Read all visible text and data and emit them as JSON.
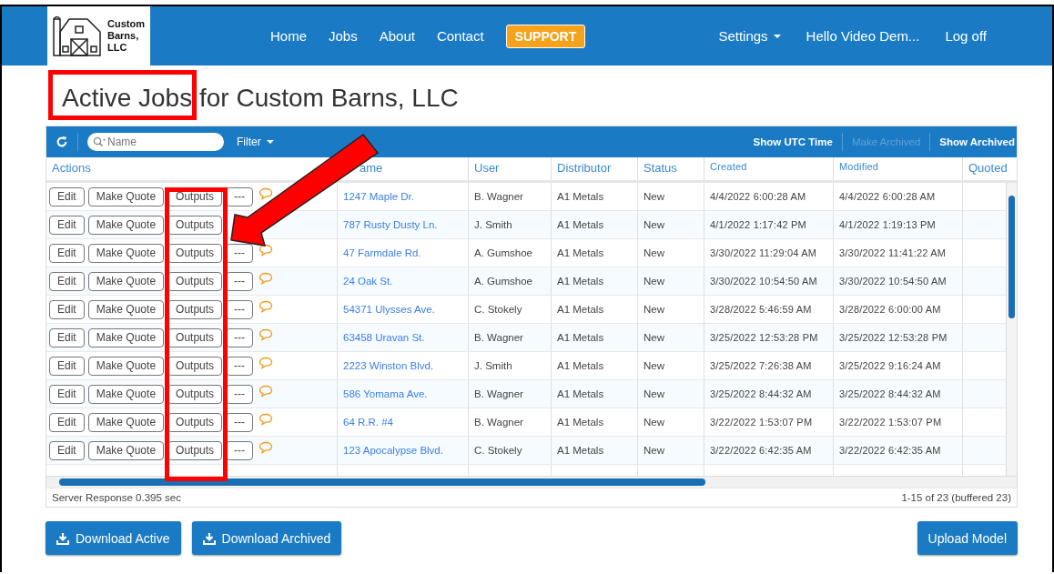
{
  "nav": {
    "logo_text": "Custom Barns, LLC",
    "links": [
      {
        "label": "Home",
        "kind": "link"
      },
      {
        "label": "Jobs",
        "kind": "link"
      },
      {
        "label": "About",
        "kind": "link"
      },
      {
        "label": "Contact",
        "kind": "link"
      },
      {
        "label": "SUPPORT",
        "kind": "highlight"
      }
    ],
    "right": [
      {
        "label": "Settings",
        "kind": "dropdown"
      },
      {
        "label": "Hello Video Dem...",
        "kind": "link"
      },
      {
        "label": "Log off",
        "kind": "link"
      }
    ]
  },
  "heading": "Active Jobs for Custom Barns, LLC",
  "toolbar": {
    "search": {
      "placeholder": "Name"
    },
    "filter": "Filter",
    "actions": [
      {
        "label": "Show UTC Time",
        "disabled": false
      },
      {
        "label": "Make Archived",
        "disabled": true
      },
      {
        "label": "Show Archived",
        "disabled": false
      }
    ]
  },
  "table": {
    "columns": [
      "Actions",
      "ame",
      "User",
      "Distributor",
      "Status",
      "Created",
      "Modified",
      "Quoted"
    ],
    "rows": [
      {
        "actions": [
          {
            "kind": "button",
            "label": "Edit"
          },
          {
            "kind": "button",
            "label": "Make Quote"
          },
          {
            "kind": "button",
            "label": "Outputs"
          },
          {
            "kind": "button",
            "label": "---"
          },
          {
            "kind": "comment"
          }
        ],
        "name": "1247 Maple Dr.",
        "user": "B. Wagner",
        "distributor": "A1 Metals",
        "status": "New",
        "created": "4/4/2022 6:00:28 AM",
        "modified": "4/4/2022 6:00:28 AM"
      },
      {
        "actions": [
          {
            "kind": "button",
            "label": "Edit"
          },
          {
            "kind": "button",
            "label": "Make Quote"
          },
          {
            "kind": "button",
            "label": "Outputs"
          }
        ],
        "name": "787 Rusty Dusty Ln.",
        "user": "J. Smith",
        "distributor": "A1 Metals",
        "status": "New",
        "created": "4/1/2022 1:17:42 PM",
        "modified": "4/1/2022 1:19:13 PM"
      },
      {
        "actions": [
          {
            "kind": "button",
            "label": "Edit"
          },
          {
            "kind": "button",
            "label": "Make Quote"
          },
          {
            "kind": "button",
            "label": "Outputs"
          },
          {
            "kind": "button",
            "label": "---"
          },
          {
            "kind": "comment"
          }
        ],
        "name": "47 Farmdale Rd.",
        "user": "A. Gumshoe",
        "distributor": "A1 Metals",
        "status": "New",
        "created": "3/30/2022 11:29:04 AM",
        "modified": "3/30/2022 11:41:22 AM"
      },
      {
        "actions": [
          {
            "kind": "button",
            "label": "Edit"
          },
          {
            "kind": "button",
            "label": "Make Quote"
          },
          {
            "kind": "button",
            "label": "Outputs"
          },
          {
            "kind": "button",
            "label": "---"
          },
          {
            "kind": "comment"
          }
        ],
        "name": "24 Oak St.",
        "user": "A. Gumshoe",
        "distributor": "A1 Metals",
        "status": "New",
        "created": "3/30/2022 10:54:50 AM",
        "modified": "3/30/2022 10:54:50 AM"
      },
      {
        "actions": [
          {
            "kind": "button",
            "label": "Edit"
          },
          {
            "kind": "button",
            "label": "Make Quote"
          },
          {
            "kind": "button",
            "label": "Outputs"
          },
          {
            "kind": "button",
            "label": "---"
          },
          {
            "kind": "comment"
          }
        ],
        "name": "54371 Ulysses Ave.",
        "user": "C. Stokely",
        "distributor": "A1 Metals",
        "status": "New",
        "created": "3/28/2022 5:46:59 AM",
        "modified": "3/28/2022 6:00:00 AM"
      },
      {
        "actions": [
          {
            "kind": "button",
            "label": "Edit"
          },
          {
            "kind": "button",
            "label": "Make Quote"
          },
          {
            "kind": "button",
            "label": "Outputs"
          },
          {
            "kind": "button",
            "label": "---"
          },
          {
            "kind": "comment"
          }
        ],
        "name": "63458 Uravan St.",
        "user": "B. Wagner",
        "distributor": "A1 Metals",
        "status": "New",
        "created": "3/25/2022 12:53:28 PM",
        "modified": "3/25/2022 12:53:28 PM"
      },
      {
        "actions": [
          {
            "kind": "button",
            "label": "Edit"
          },
          {
            "kind": "button",
            "label": "Make Quote"
          },
          {
            "kind": "button",
            "label": "Outputs"
          },
          {
            "kind": "button",
            "label": "---"
          },
          {
            "kind": "comment"
          }
        ],
        "name": "2223 Winston Blvd.",
        "user": "J. Smith",
        "distributor": "A1 Metals",
        "status": "New",
        "created": "3/25/2022 7:26:38 AM",
        "modified": "3/25/2022 9:16:24 AM"
      },
      {
        "actions": [
          {
            "kind": "button",
            "label": "Edit"
          },
          {
            "kind": "button",
            "label": "Make Quote"
          },
          {
            "kind": "button",
            "label": "Outputs"
          },
          {
            "kind": "button",
            "label": "---"
          },
          {
            "kind": "comment"
          }
        ],
        "name": "586 Yomama Ave.",
        "user": "B. Wagner",
        "distributor": "A1 Metals",
        "status": "New",
        "created": "3/25/2022 8:44:32 AM",
        "modified": "3/25/2022 8:44:32 AM"
      },
      {
        "actions": [
          {
            "kind": "button",
            "label": "Edit"
          },
          {
            "kind": "button",
            "label": "Make Quote"
          },
          {
            "kind": "button",
            "label": "Outputs"
          },
          {
            "kind": "button",
            "label": "---"
          },
          {
            "kind": "comment"
          }
        ],
        "name": "64 R.R. #4",
        "user": "B. Wagner",
        "distributor": "A1 Metals",
        "status": "New",
        "created": "3/22/2022 1:53:07 PM",
        "modified": "3/22/2022 1:53:07 PM"
      },
      {
        "actions": [
          {
            "kind": "button",
            "label": "Edit"
          },
          {
            "kind": "button",
            "label": "Make Quote"
          },
          {
            "kind": "button",
            "label": "Outputs"
          },
          {
            "kind": "button",
            "label": "---"
          },
          {
            "kind": "comment"
          }
        ],
        "name": "123 Apocalypse Blvd.",
        "user": "C. Stokely",
        "distributor": "A1 Metals",
        "status": "New",
        "created": "3/22/2022 6:42:35 AM",
        "modified": "3/22/2022 6:42:35 AM"
      }
    ]
  },
  "footer": {
    "response": "Server Response 0.395 sec",
    "paging": "1-15 of 23 (buffered 23)"
  },
  "buttons": [
    {
      "label": "Download Active",
      "kind": "download"
    },
    {
      "label": "Download Archived",
      "kind": "download"
    },
    {
      "label": "Upload Model",
      "kind": "plain"
    }
  ]
}
